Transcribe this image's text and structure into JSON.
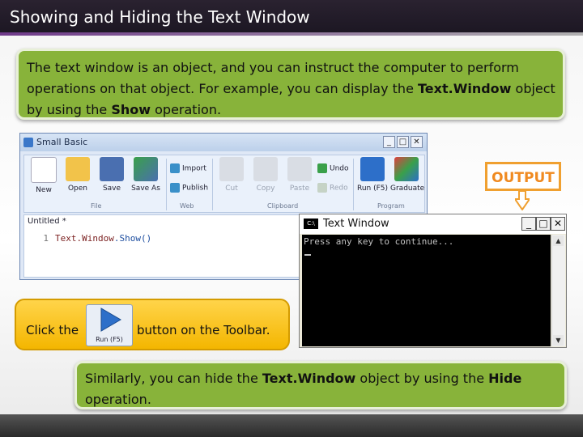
{
  "slide": {
    "title": "Showing and Hiding the Text Window",
    "top_text": {
      "p1": "The text window is an object, and you can instruct the computer to perform",
      "p2": "operations on that object. For example, you can display the ",
      "b1": "Text.Window",
      "p3": " object",
      "p4": "by using the ",
      "b2": "Show",
      "p5": " operation."
    },
    "bottom_text": {
      "p1": "Similarly, you can hide the ",
      "b1": "Text.Window",
      "p2": " object by using the ",
      "b2": "Hide",
      "p3": "operation."
    },
    "output_label": "OUTPUT",
    "click_panel": {
      "prefix": "Click the",
      "suffix": "button on the Toolbar.",
      "run_label": "Run (F5)"
    }
  },
  "small_basic": {
    "title": "Small Basic",
    "buttons": {
      "new": "New",
      "open": "Open",
      "save": "Save",
      "save_as": "Save As",
      "import": "Import",
      "publish": "Publish",
      "cut": "Cut",
      "copy": "Copy",
      "paste": "Paste",
      "undo": "Undo",
      "redo": "Redo",
      "run": "Run (F5)",
      "graduate": "Graduate"
    },
    "groups": {
      "file": "File",
      "web": "Web",
      "clipboard": "Clipboard",
      "program": "Program"
    },
    "editor": {
      "tab": "Untitled *",
      "line_no": "1",
      "code_obj": "Text.Window",
      "code_op": ".Show()"
    }
  },
  "console": {
    "title": "Text Window",
    "icon_text": "C:\\",
    "output_line": "Press any key to continue..."
  },
  "colors": {
    "green_box": "#88b33a",
    "output_orange": "#f08a20",
    "panel_yellow": "#f4b600",
    "title_bar": "#1b1622"
  }
}
